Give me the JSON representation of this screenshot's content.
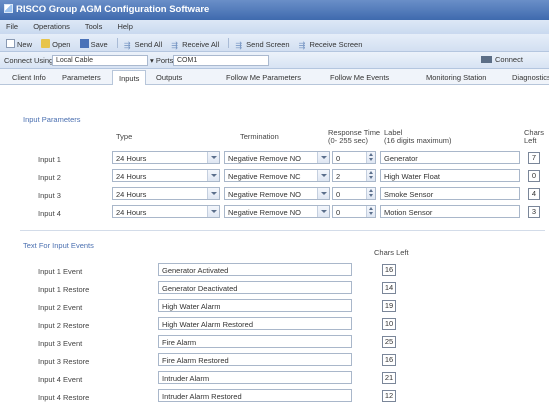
{
  "window": {
    "title": "RISCO Group   AGM Configuration Software"
  },
  "menu": [
    "File",
    "Operations",
    "Tools",
    "Help"
  ],
  "toolbar": {
    "new": "New",
    "open": "Open",
    "save": "Save",
    "send_all": "Send All",
    "receive_all": "Receive All",
    "send_screen": "Send Screen",
    "receive_screen": "Receive Screen"
  },
  "connection": {
    "label": "Connect Using",
    "value": "Local Cable",
    "ports_label": "Ports",
    "ports_value": "COM1",
    "connect": "Connect"
  },
  "tabs": [
    "Client Info",
    "Parameters",
    "Inputs",
    "Outputs",
    "Follow Me Parameters",
    "Follow Me Events",
    "Monitoring Station",
    "Diagnostics"
  ],
  "active_tab": "Inputs",
  "input_parameters": {
    "title": "Input Parameters",
    "headers": {
      "type": "Type",
      "termination": "Termination",
      "response_line1": "Response Time",
      "response_line2": "(0- 255 sec)",
      "label_line1": "Label",
      "label_line2": "(16 digits maximum)",
      "chars_line1": "Chars",
      "chars_line2": "Left"
    },
    "rows": [
      {
        "name": "Input 1",
        "type": "24 Hours",
        "termination": "Negative Remove NO",
        "response": "0",
        "label": "Generator",
        "chars_left": "7"
      },
      {
        "name": "Input 2",
        "type": "24 Hours",
        "termination": "Negative Remove NC",
        "response": "2",
        "label": "High Water Float",
        "chars_left": "0"
      },
      {
        "name": "Input 3",
        "type": "24 Hours",
        "termination": "Negative Remove NO",
        "response": "0",
        "label": "Smoke Sensor",
        "chars_left": "4"
      },
      {
        "name": "Input 4",
        "type": "24 Hours",
        "termination": "Negative Remove NO",
        "response": "0",
        "label": "Motion Sensor",
        "chars_left": "3"
      }
    ]
  },
  "input_events": {
    "title": "Text For Input Events",
    "chars_left_header": "Chars Left",
    "rows": [
      {
        "name": "Input 1 Event",
        "text": "Generator Activated",
        "chars_left": "16"
      },
      {
        "name": "Input 1 Restore",
        "text": "Generator Deactivated",
        "chars_left": "14"
      },
      {
        "name": "Input 2 Event",
        "text": "High Water Alarm",
        "chars_left": "19"
      },
      {
        "name": "Input 2 Restore",
        "text": "High Water Alarm Restored",
        "chars_left": "10"
      },
      {
        "name": "Input 3 Event",
        "text": "Fire Alarm",
        "chars_left": "25"
      },
      {
        "name": "Input 3 Restore",
        "text": "Fire Alarm Restored",
        "chars_left": "16"
      },
      {
        "name": "Input 4 Event",
        "text": "Intruder Alarm",
        "chars_left": "21"
      },
      {
        "name": "Input 4 Restore",
        "text": "Intruder Alarm Restored",
        "chars_left": "12"
      }
    ]
  }
}
